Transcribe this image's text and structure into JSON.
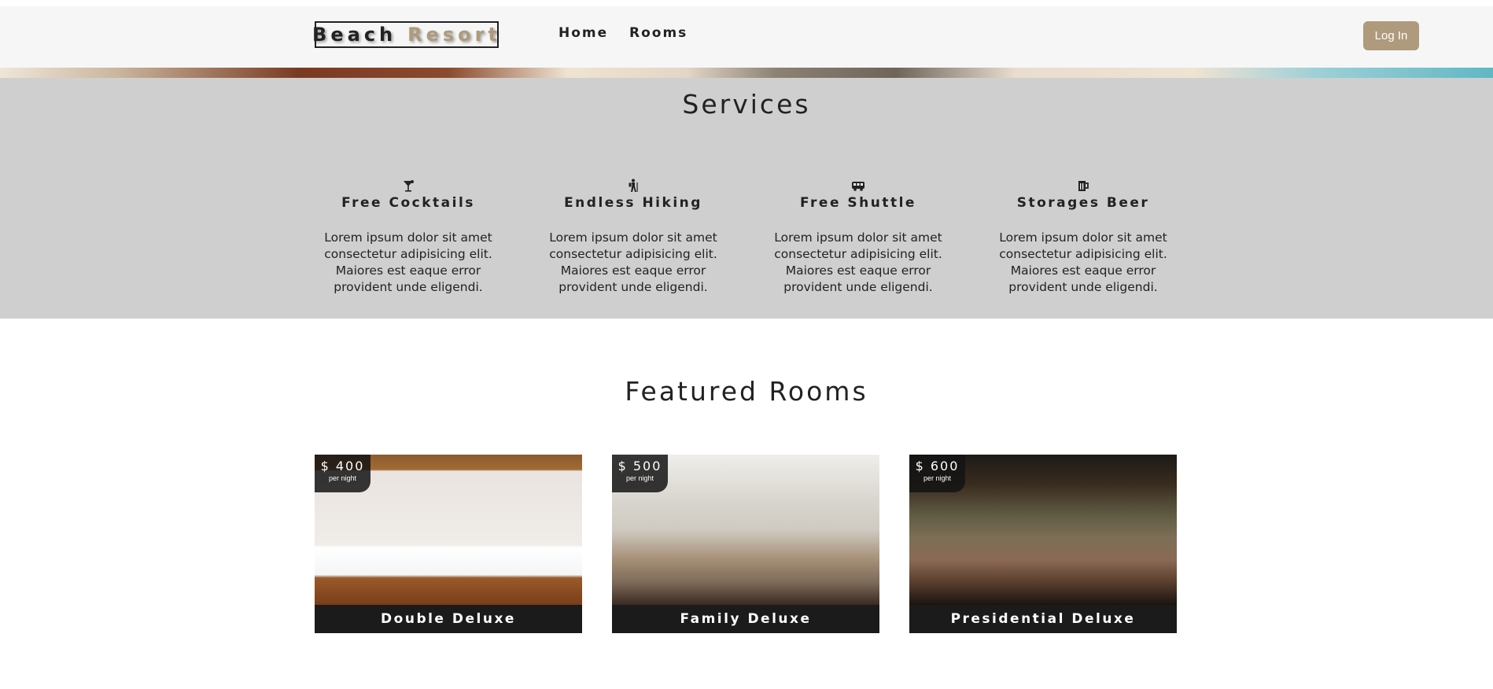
{
  "navbar": {
    "logo_word1": "Beach",
    "logo_word2": "Resort",
    "links": [
      {
        "label": "Home"
      },
      {
        "label": "Rooms"
      }
    ],
    "login_label": "Log In"
  },
  "services": {
    "title": "Services",
    "items": [
      {
        "icon": "cocktail-icon",
        "title": "Free Cocktails",
        "text": "Lorem ipsum dolor sit amet consectetur adipisicing elit. Maiores est eaque error provident unde eligendi."
      },
      {
        "icon": "hiking-icon",
        "title": "Endless Hiking",
        "text": "Lorem ipsum dolor sit amet consectetur adipisicing elit. Maiores est eaque error provident unde eligendi."
      },
      {
        "icon": "shuttle-icon",
        "title": "Free Shuttle",
        "text": "Lorem ipsum dolor sit amet consectetur adipisicing elit. Maiores est eaque error provident unde eligendi."
      },
      {
        "icon": "beer-icon",
        "title": "Storages Beer",
        "text": "Lorem ipsum dolor sit amet consectetur adipisicing elit. Maiores est eaque error provident unde eligendi."
      }
    ]
  },
  "featured": {
    "title": "Featured Rooms",
    "rooms": [
      {
        "price": "$ 400",
        "per": "per night",
        "name": "Double Deluxe"
      },
      {
        "price": "$ 500",
        "per": "per night",
        "name": "Family Deluxe"
      },
      {
        "price": "$ 600",
        "per": "per night",
        "name": "Presidential Deluxe"
      }
    ]
  },
  "colors": {
    "accent": "#af9a7d",
    "services_bg": "#cfcfcf",
    "navbar_bg": "#f6f6f6",
    "room_label_bg": "#1b1b1b"
  }
}
